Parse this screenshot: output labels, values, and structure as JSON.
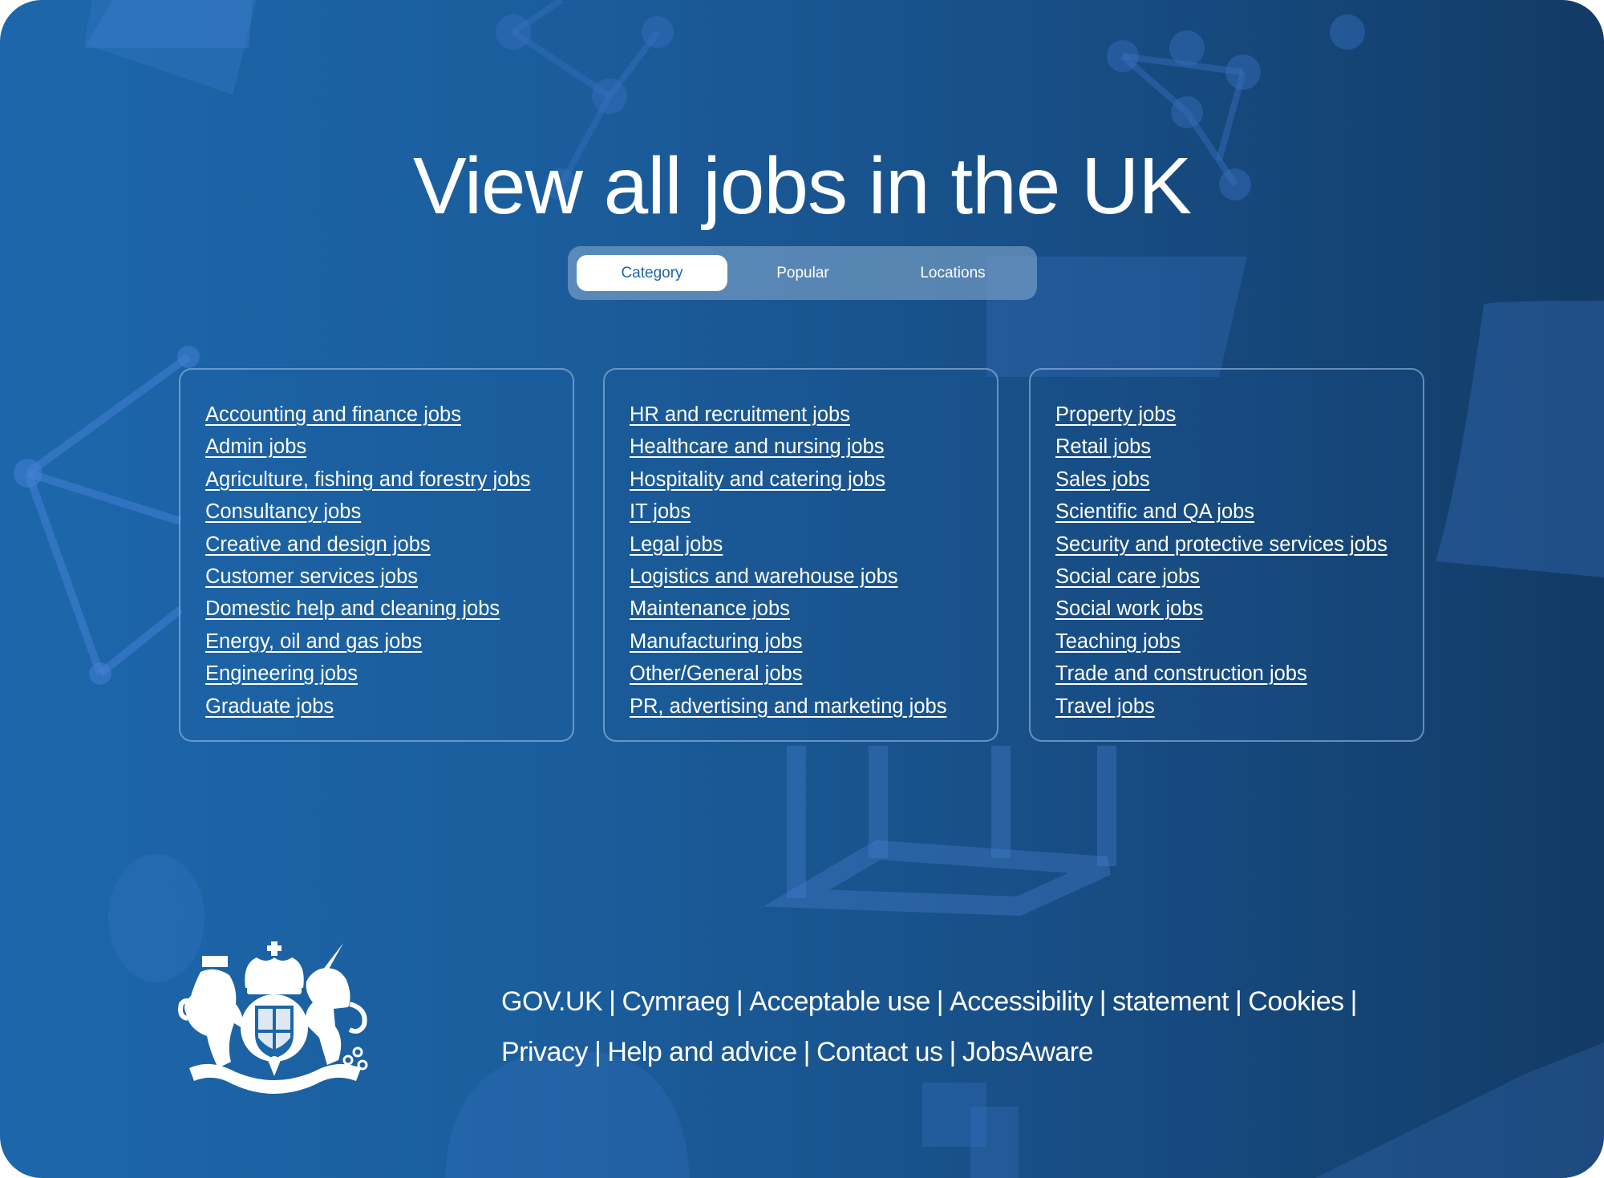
{
  "page": {
    "title": "View all jobs in the UK"
  },
  "tabs": [
    {
      "label": "Category",
      "active": true
    },
    {
      "label": "Popular",
      "active": false
    },
    {
      "label": "Locations",
      "active": false
    }
  ],
  "categories": {
    "column_1": [
      "Accounting and finance jobs",
      "Admin jobs",
      "Agriculture, fishing and forestry jobs",
      "Consultancy jobs",
      "Creative and design jobs",
      "Customer services jobs",
      "Domestic help and cleaning jobs",
      "Energy, oil and gas jobs",
      "Engineering jobs",
      "Graduate jobs"
    ],
    "column_2": [
      "HR and recruitment jobs",
      "Healthcare and nursing jobs",
      "Hospitality and catering jobs",
      "IT jobs",
      "Legal jobs",
      "Logistics and warehouse jobs",
      "Maintenance jobs",
      "Manufacturing jobs",
      "Other/General jobs",
      "PR, advertising and marketing jobs"
    ],
    "column_3": [
      "Property jobs",
      "Retail jobs",
      "Sales jobs",
      "Scientific and QA jobs",
      "Security and protective services jobs",
      "Social care jobs",
      "Social work jobs",
      "Teaching jobs",
      "Trade and construction jobs",
      "Travel jobs"
    ]
  },
  "footer": {
    "crest_icon": "royal-coat-of-arms-icon",
    "links": [
      "GOV.UK",
      "Cymraeg",
      "Acceptable use",
      "Accessibility",
      "statement",
      "Cookies",
      "Privacy",
      "Help and advice",
      "Contact us",
      "JobsAware"
    ],
    "separator": "|"
  },
  "colors": {
    "background_left": "#1c67ab",
    "background_right": "#123b66",
    "active_tab_text": "#1c63a8",
    "text": "#ffffff"
  }
}
